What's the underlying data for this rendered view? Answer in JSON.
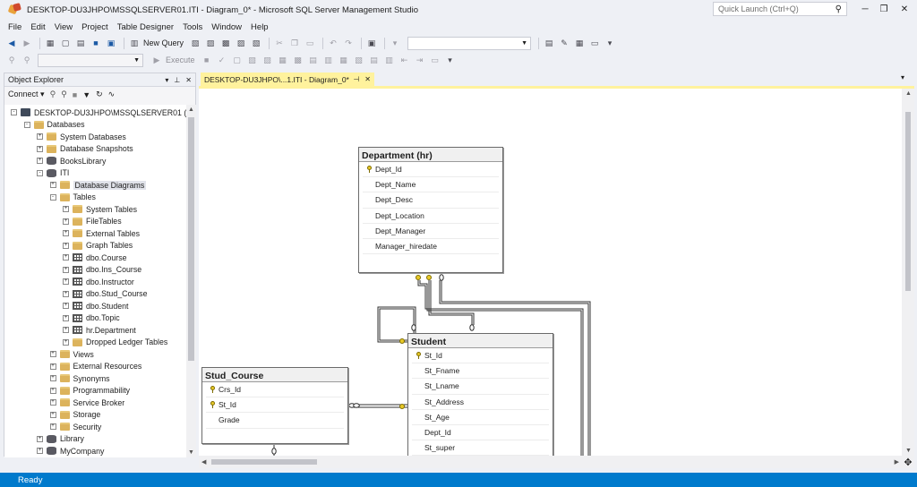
{
  "window": {
    "title": "DESKTOP-DU3JHPO\\MSSQLSERVER01.ITI - Diagram_0* - Microsoft SQL Server Management Studio",
    "quick_launch_placeholder": "Quick Launch (Ctrl+Q)"
  },
  "menu": [
    "File",
    "Edit",
    "View",
    "Project",
    "Table Designer",
    "Tools",
    "Window",
    "Help"
  ],
  "toolbar": {
    "new_query": "New Query",
    "execute": "Execute"
  },
  "object_explorer": {
    "title": "Object Explorer",
    "connect": "Connect",
    "tree": [
      {
        "label": "DESKTOP-DU3JHPO\\MSSQLSERVER01 (SQ",
        "level": 0,
        "icon": "server",
        "exp": "-"
      },
      {
        "label": "Databases",
        "level": 1,
        "icon": "folder",
        "exp": "-"
      },
      {
        "label": "System Databases",
        "level": 2,
        "icon": "folder",
        "exp": "+"
      },
      {
        "label": "Database Snapshots",
        "level": 2,
        "icon": "folder",
        "exp": "+"
      },
      {
        "label": "BooksLibrary",
        "level": 2,
        "icon": "db",
        "exp": "+"
      },
      {
        "label": "ITI",
        "level": 2,
        "icon": "db",
        "exp": "-"
      },
      {
        "label": "Database Diagrams",
        "level": 3,
        "icon": "folder",
        "exp": "+",
        "selected": true
      },
      {
        "label": "Tables",
        "level": 3,
        "icon": "folder",
        "exp": "-"
      },
      {
        "label": "System Tables",
        "level": 4,
        "icon": "folder",
        "exp": "+"
      },
      {
        "label": "FileTables",
        "level": 4,
        "icon": "folder",
        "exp": "+"
      },
      {
        "label": "External Tables",
        "level": 4,
        "icon": "folder",
        "exp": "+"
      },
      {
        "label": "Graph Tables",
        "level": 4,
        "icon": "folder",
        "exp": "+"
      },
      {
        "label": "dbo.Course",
        "level": 4,
        "icon": "table",
        "exp": "+"
      },
      {
        "label": "dbo.Ins_Course",
        "level": 4,
        "icon": "table",
        "exp": "+"
      },
      {
        "label": "dbo.Instructor",
        "level": 4,
        "icon": "table",
        "exp": "+"
      },
      {
        "label": "dbo.Stud_Course",
        "level": 4,
        "icon": "table",
        "exp": "+"
      },
      {
        "label": "dbo.Student",
        "level": 4,
        "icon": "table",
        "exp": "+"
      },
      {
        "label": "dbo.Topic",
        "level": 4,
        "icon": "table",
        "exp": "+"
      },
      {
        "label": "hr.Department",
        "level": 4,
        "icon": "table",
        "exp": "+"
      },
      {
        "label": "Dropped Ledger Tables",
        "level": 4,
        "icon": "folder",
        "exp": "+"
      },
      {
        "label": "Views",
        "level": 3,
        "icon": "folder",
        "exp": "+"
      },
      {
        "label": "External Resources",
        "level": 3,
        "icon": "folder",
        "exp": "+"
      },
      {
        "label": "Synonyms",
        "level": 3,
        "icon": "folder",
        "exp": "+"
      },
      {
        "label": "Programmability",
        "level": 3,
        "icon": "folder",
        "exp": "+"
      },
      {
        "label": "Service Broker",
        "level": 3,
        "icon": "folder",
        "exp": "+"
      },
      {
        "label": "Storage",
        "level": 3,
        "icon": "folder",
        "exp": "+"
      },
      {
        "label": "Security",
        "level": 3,
        "icon": "folder",
        "exp": "+"
      },
      {
        "label": "Library",
        "level": 2,
        "icon": "db",
        "exp": "+"
      },
      {
        "label": "MyCompany",
        "level": 2,
        "icon": "db",
        "exp": "+"
      }
    ]
  },
  "document_tab": {
    "label": "DESKTOP-DU3JHPO\\...1.ITI - Diagram_0*"
  },
  "diagram": {
    "tables": [
      {
        "id": "department",
        "title": "Department (hr)",
        "columns": [
          {
            "name": "Dept_Id",
            "pk": true
          },
          {
            "name": "Dept_Name"
          },
          {
            "name": "Dept_Desc"
          },
          {
            "name": "Dept_Location"
          },
          {
            "name": "Dept_Manager"
          },
          {
            "name": "Manager_hiredate"
          }
        ]
      },
      {
        "id": "student",
        "title": "Student",
        "columns": [
          {
            "name": "St_Id",
            "pk": true
          },
          {
            "name": "St_Fname"
          },
          {
            "name": "St_Lname"
          },
          {
            "name": "St_Address"
          },
          {
            "name": "St_Age"
          },
          {
            "name": "Dept_Id"
          },
          {
            "name": "St_super"
          }
        ]
      },
      {
        "id": "stud_course",
        "title": "Stud_Course",
        "columns": [
          {
            "name": "Crs_Id",
            "pk": true
          },
          {
            "name": "St_Id",
            "pk": true
          },
          {
            "name": "Grade"
          }
        ]
      }
    ]
  },
  "status": {
    "text": "Ready"
  }
}
